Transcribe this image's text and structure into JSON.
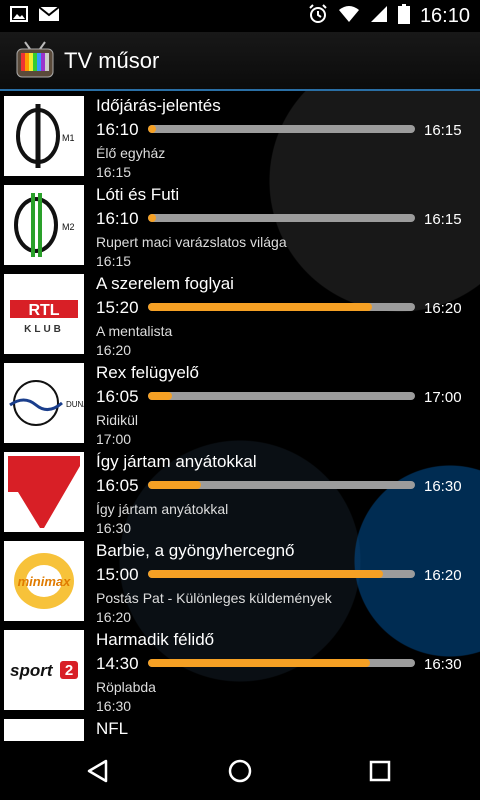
{
  "status_bar": {
    "time": "16:10",
    "left_icons": [
      "image-icon",
      "gmail-icon"
    ],
    "right_icons": [
      "alarm-icon",
      "wifi-icon",
      "signal-icon",
      "battery-icon"
    ]
  },
  "action_bar": {
    "title": "TV műsor",
    "icon": "tv-icon"
  },
  "colors": {
    "progress_fill": "#f5a024",
    "progress_track": "#9c9c9c",
    "accent_divider": "#2a6fa5"
  },
  "programs": [
    {
      "channel": "M1",
      "title": "Időjárás-jelentés",
      "start": "16:10",
      "end": "16:15",
      "progress": 0.0,
      "next_title": "Élő egyház",
      "next_time": "16:15"
    },
    {
      "channel": "M2",
      "title": "Lóti és Futi",
      "start": "16:10",
      "end": "16:15",
      "progress": 0.0,
      "next_title": "Rupert maci varázslatos világa",
      "next_time": "16:15"
    },
    {
      "channel": "RTL KLUB",
      "title": "A szerelem foglyai",
      "start": "15:20",
      "end": "16:20",
      "progress": 0.84,
      "next_title": "A mentalista",
      "next_time": "16:20"
    },
    {
      "channel": "DUNA",
      "title": "Rex felügyelő",
      "start": "16:05",
      "end": "17:00",
      "progress": 0.09,
      "next_title": "Ridikül",
      "next_time": "17:00"
    },
    {
      "channel": "PRO7",
      "title": "Így jártam anyátokkal",
      "start": "16:05",
      "end": "16:30",
      "progress": 0.2,
      "next_title": "Így jártam anyátokkal",
      "next_time": "16:30"
    },
    {
      "channel": "MINIMAX",
      "title": "Barbie, a gyöngyhercegnő",
      "start": "15:00",
      "end": "16:20",
      "progress": 0.88,
      "next_title": "Postás Pat - Különleges küldemények",
      "next_time": "16:20"
    },
    {
      "channel": "SPORT2",
      "title": "Harmadik félidő",
      "start": "14:30",
      "end": "16:30",
      "progress": 0.83,
      "next_title": "Röplabda",
      "next_time": "16:30"
    },
    {
      "channel": "",
      "title": "NFL",
      "start": "",
      "end": "",
      "progress": null,
      "next_title": "",
      "next_time": ""
    }
  ],
  "nav_bar": {
    "buttons": [
      "back-icon",
      "home-icon",
      "recents-icon"
    ]
  }
}
